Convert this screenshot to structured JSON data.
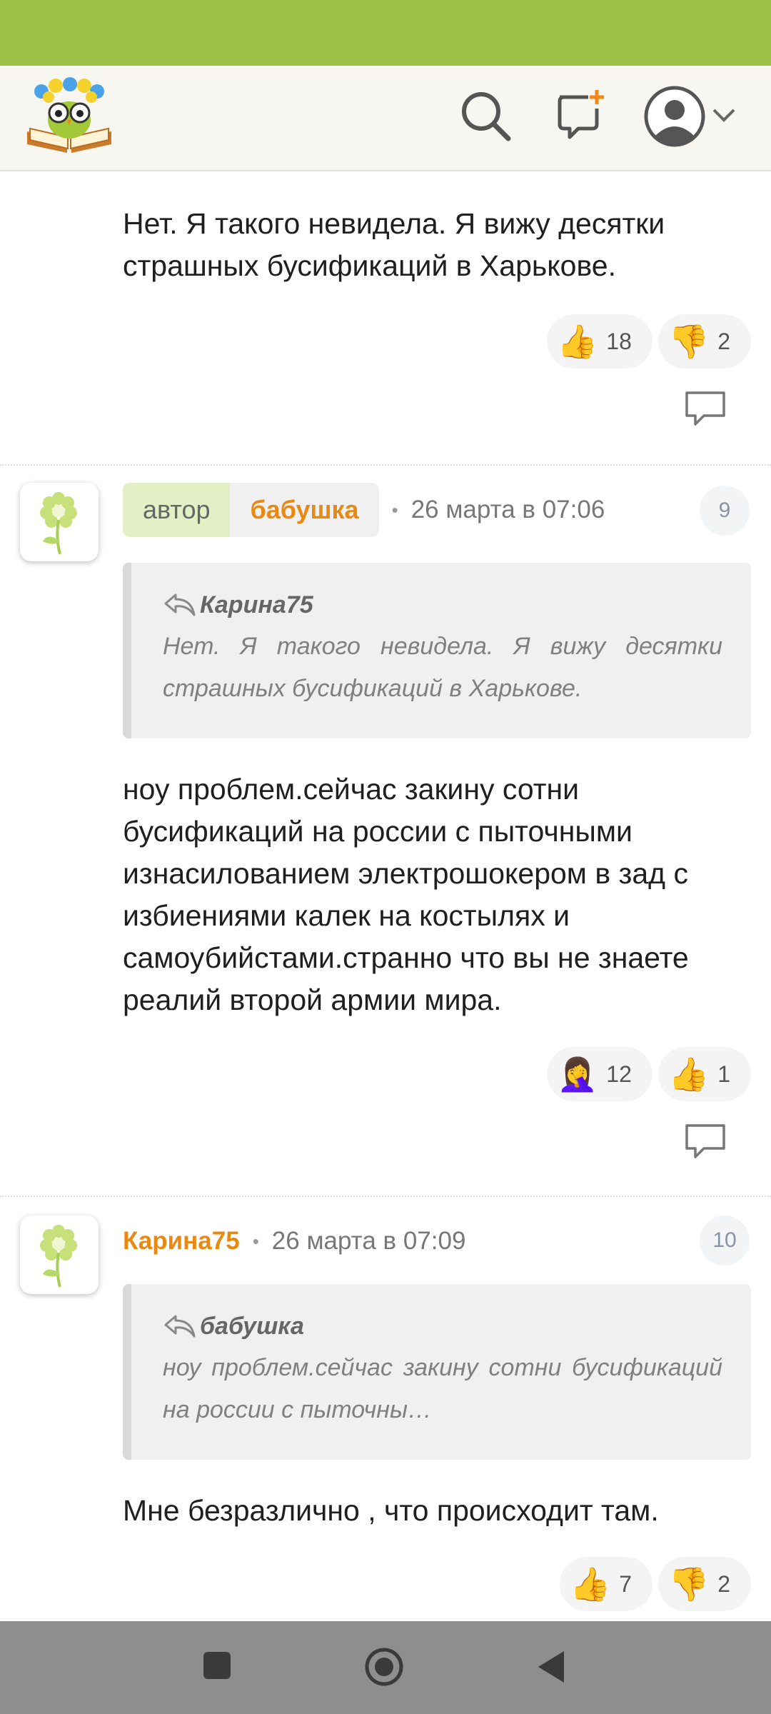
{
  "header": {
    "logo": "owl-on-book-logo",
    "icons": [
      "search-icon",
      "new-message-icon",
      "user-avatar-icon",
      "chevron-down-icon"
    ]
  },
  "comments": [
    {
      "text": "Нет. Я такого невидела. Я вижу десятки страшных бусификаций в Харькове.",
      "reactions": [
        {
          "emoji": "👍",
          "count": "18"
        },
        {
          "emoji": "👎",
          "count": "2"
        }
      ]
    },
    {
      "author_badge": "автор",
      "username": "бабушка",
      "separator": "•",
      "date": "26 марта в 07:06",
      "number": "9",
      "quote": {
        "author": "Карина75",
        "text": "Нет. Я такого невидела. Я вижу десятки страшных бусификаций в Харькове."
      },
      "text": "ноу проблем.сейчас закину сотни бусификаций на россии с пыточными изнасилованием электрошокером в зад с избиениями калек на костылях и самоубийстами.странно что вы не знаете реалий второй армии мира.",
      "reactions": [
        {
          "emoji": "🤦‍♀️",
          "count": "12"
        },
        {
          "emoji": "👍",
          "count": "1"
        }
      ]
    },
    {
      "username": "Карина75",
      "separator": "•",
      "date": "26 марта в 07:09",
      "number": "10",
      "quote": {
        "author": "бабушка",
        "text": "ноу проблем.сейчас закину сотни бусификаций на россии с пыточны…"
      },
      "text": "Мне безразлично , что происходит там.",
      "reactions": [
        {
          "emoji": "👍",
          "count": "7"
        },
        {
          "emoji": "👎",
          "count": "2"
        }
      ]
    }
  ],
  "navbar": {
    "icons": [
      "recent-apps-icon",
      "home-icon",
      "back-icon"
    ]
  }
}
